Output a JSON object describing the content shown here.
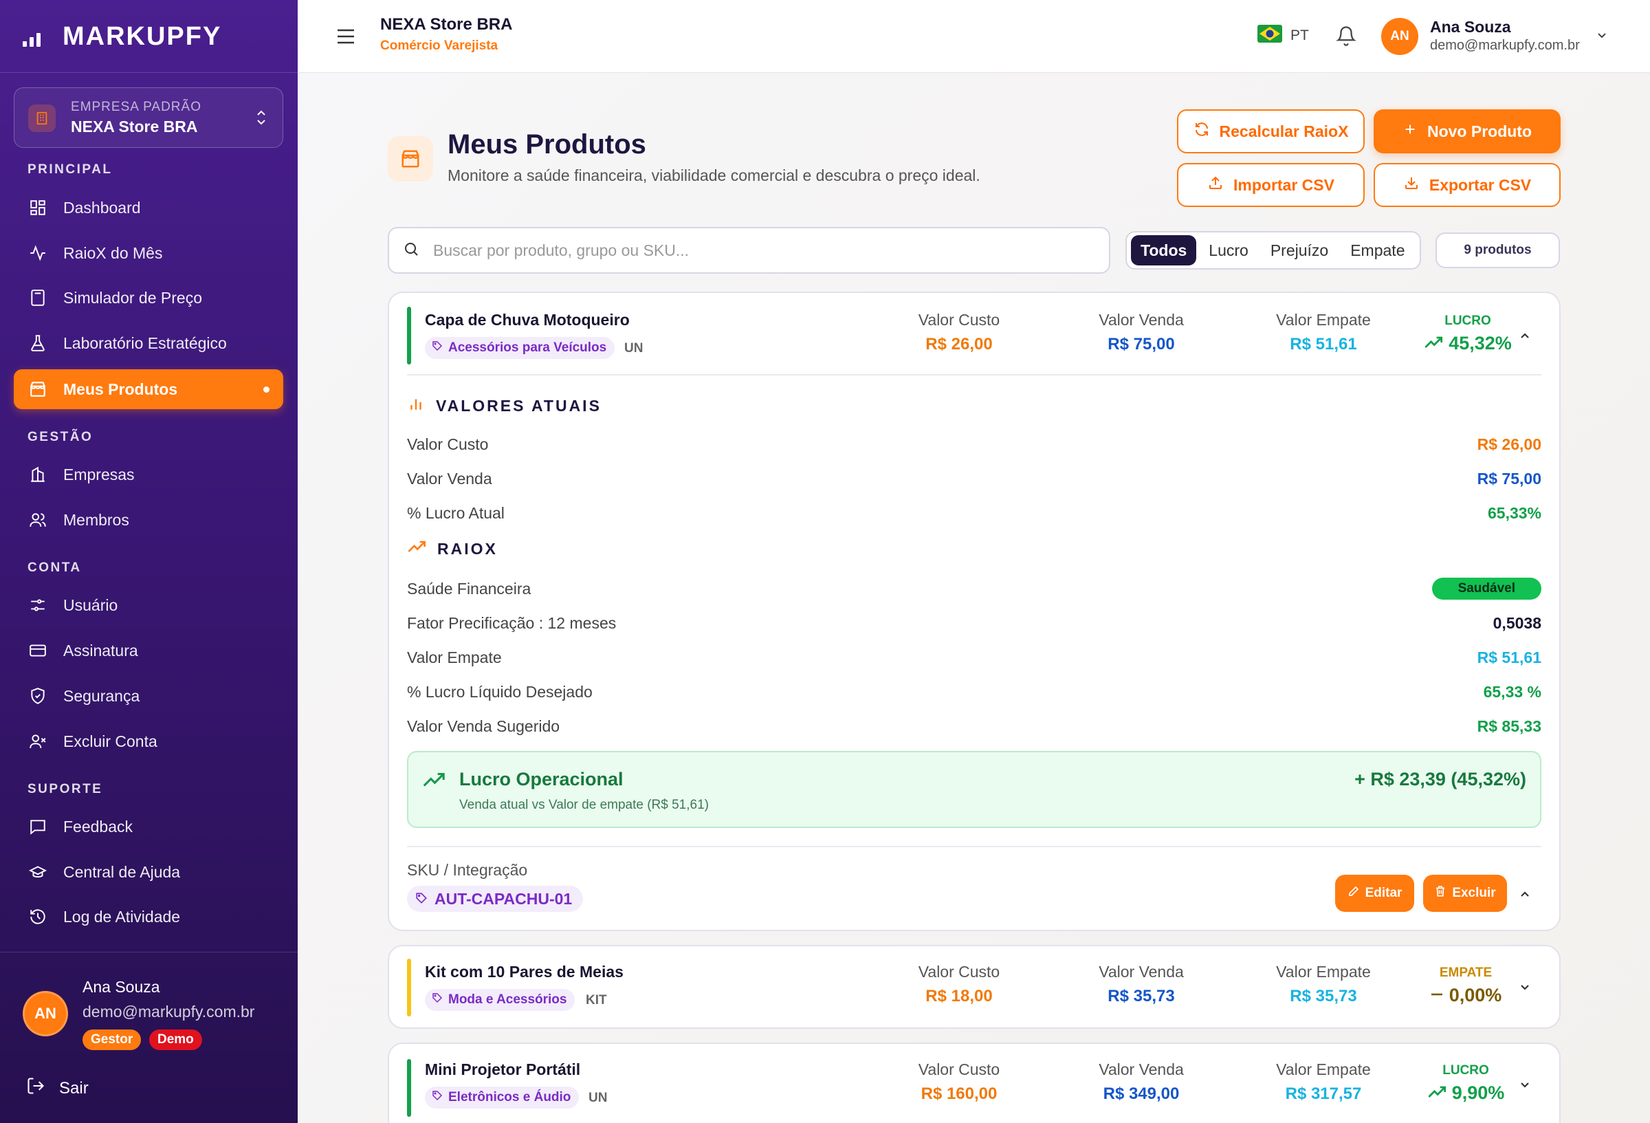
{
  "brand": {
    "name": "MARKUPFY"
  },
  "sidebar": {
    "company_label": "EMPRESA PADRÃO",
    "company_name": "NEXA Store BRA",
    "sections": {
      "principal": "PRINCIPAL",
      "gestao": "GESTÃO",
      "conta": "CONTA",
      "suporte": "SUPORTE"
    },
    "items": [
      {
        "label": "Dashboard",
        "icon": "grid-icon"
      },
      {
        "label": "RaioX do Mês",
        "icon": "activity-icon"
      },
      {
        "label": "Simulador de Preço",
        "icon": "calculator-icon"
      },
      {
        "label": "Laboratório Estratégico",
        "icon": "flask-icon"
      },
      {
        "label": "Meus Produtos",
        "icon": "box-icon",
        "active": true
      },
      {
        "label": "Empresas",
        "icon": "building-icon"
      },
      {
        "label": "Membros",
        "icon": "users-icon"
      },
      {
        "label": "Usuário",
        "icon": "sliders-icon"
      },
      {
        "label": "Assinatura",
        "icon": "credit-card-icon"
      },
      {
        "label": "Segurança",
        "icon": "shield-icon"
      },
      {
        "label": "Excluir Conta",
        "icon": "user-x-icon"
      },
      {
        "label": "Feedback",
        "icon": "message-square-icon"
      },
      {
        "label": "Central de Ajuda",
        "icon": "graduation-cap-icon"
      },
      {
        "label": "Log de Atividade",
        "icon": "history-icon"
      }
    ],
    "user": {
      "initials": "AN",
      "name": "Ana Souza",
      "email": "demo@markupfy.com.br",
      "badges": [
        "Gestor",
        "Demo"
      ]
    },
    "logout_label": "Sair"
  },
  "topbar": {
    "store_name": "NEXA Store BRA",
    "segment": "Comércio Varejista",
    "language": "PT",
    "user_initials": "AN",
    "user_name": "Ana Souza",
    "user_email": "demo@markupfy.com.br"
  },
  "page": {
    "title": "Meus Produtos",
    "subtitle": "Monitore a saúde financeira, viabilidade comercial e descubra o preço ideal.",
    "buttons": {
      "recalc": "Recalcular RaioX",
      "new": "Novo Produto",
      "import": "Importar CSV",
      "export": "Exportar CSV"
    },
    "search_placeholder": "Buscar por produto, grupo ou SKU...",
    "filters": [
      "Todos",
      "Lucro",
      "Prejuízo",
      "Empate"
    ],
    "active_filter": "Todos",
    "count_label": "9 produtos"
  },
  "labels": {
    "cost": "Valor Custo",
    "sale": "Valor Venda",
    "breakeven": "Valor Empate"
  },
  "products": [
    {
      "name": "Capa de Chuva Motoqueiro",
      "category": "Acessórios para Veículos",
      "unit": "UN",
      "cost": "R$ 26,00",
      "sale": "R$ 75,00",
      "breakeven": "R$ 51,61",
      "status": "LUCRO",
      "margin": "45,32%",
      "status_color": "#12a04a",
      "expanded": true
    },
    {
      "name": "Kit com 10 Pares de Meias",
      "category": "Moda e Acessórios",
      "unit": "KIT",
      "cost": "R$ 18,00",
      "sale": "R$ 35,73",
      "breakeven": "R$ 35,73",
      "status": "EMPATE",
      "margin": "0,00%",
      "status_color": "#c98a00",
      "expanded": false
    },
    {
      "name": "Mini Projetor Portátil",
      "category": "Eletrônicos e Áudio",
      "unit": "UN",
      "cost": "R$ 160,00",
      "sale": "R$ 349,00",
      "breakeven": "R$ 317,57",
      "status": "LUCRO",
      "margin": "9,90%",
      "status_color": "#12a04a",
      "expanded": false
    }
  ],
  "detail": {
    "current_title": "VALORES ATUAIS",
    "current_rows": [
      {
        "label": "Valor Custo",
        "value": "R$ 26,00"
      },
      {
        "label": "Valor Venda",
        "value": "R$ 75,00"
      },
      {
        "label": "% Lucro Atual",
        "value": "65,33%"
      }
    ],
    "raiox_title": "RAIOX",
    "health_label": "Saúde Financeira",
    "health_value": "Saudável",
    "raiox_rows": [
      {
        "label": "Fator Precificação : 12 meses",
        "value": "0,5038"
      },
      {
        "label": "Valor Empate",
        "value": "R$ 51,61"
      },
      {
        "label": "% Lucro Líquido Desejado",
        "value": "65,33 %"
      },
      {
        "label": "Valor Venda Sugerido",
        "value": "R$ 85,33"
      }
    ],
    "op_title": "Lucro Operacional",
    "op_sub": "Venda atual vs Valor de empate (R$ 51,61)",
    "op_value": "+ R$ 23,39 (45,32%)",
    "sku_label": "SKU / Integração",
    "sku": "AUT-CAPACHU-01",
    "edit_label": "Editar",
    "delete_label": "Excluir"
  },
  "colors": {
    "accent": "#ff7a0f",
    "cost": "#f07a0a",
    "sale": "#1556c9",
    "breakeven": "#19b3e0",
    "profit": "#12a04a",
    "sidebar": "#3a1775"
  }
}
